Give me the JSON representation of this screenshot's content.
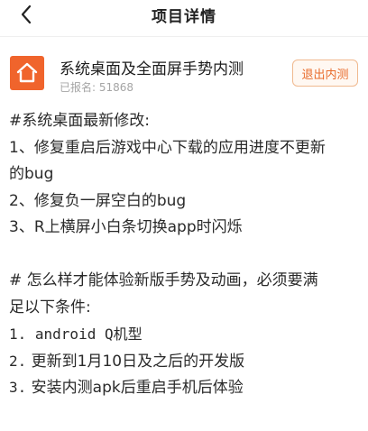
{
  "header": {
    "title": "项目详情",
    "back_icon": "chevron-left-icon"
  },
  "project": {
    "icon": "home-icon",
    "icon_color": "#f0642c",
    "name": "系统桌面及全面屏手势内测",
    "signup_count": "已报名: 51868",
    "quit_label": "退出内测",
    "quit_color": "#e86b2b"
  },
  "description": {
    "changelog_title": "#系统桌面最新修改:",
    "changes": [
      "1、修复重启后游戏中心下载的应用进度不更新",
      "的bug",
      "2、修复负一屏空白的bug",
      "3、R上横屏小白条切换app时闪烁"
    ],
    "conditions_title_1": "# 怎么样才能体验新版手势及动画，必须要满",
    "conditions_title_2": "足以下条件:",
    "conditions": [
      {
        "num": "1.",
        "text": " android Q机型"
      },
      {
        "num": "2.",
        "text": " 更新到1月10日及之后的开发版"
      },
      {
        "num": "3.",
        "text": " 安装内测apk后重启手机后体验"
      }
    ]
  }
}
